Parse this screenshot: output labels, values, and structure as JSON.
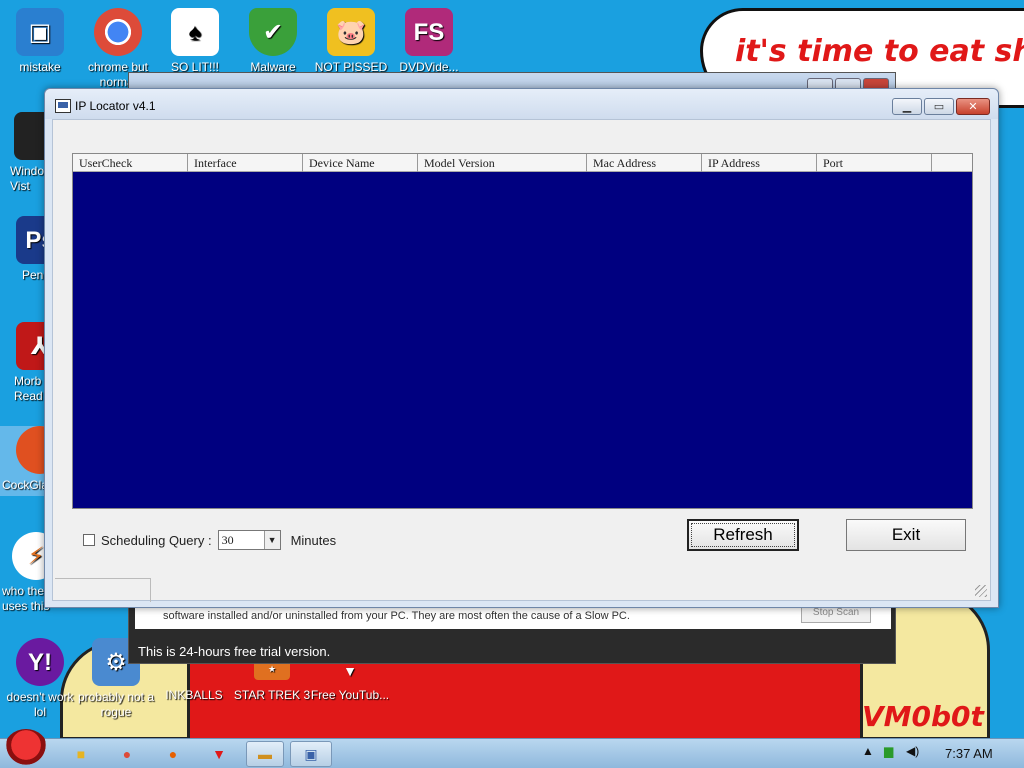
{
  "wallpaper": {
    "bubble_text": "it's time to eat shit and show",
    "signature": "VM0b0t"
  },
  "desktop_icons": [
    {
      "label": "mistake",
      "icon": "computer-icon",
      "color": "#2a7fd0"
    },
    {
      "label": "chrome but normal",
      "icon": "chrome-icon",
      "color": "#dd4b39"
    },
    {
      "label": "SO LIT!!!",
      "icon": "cards-icon",
      "color": "#ffffff"
    },
    {
      "label": "Malware",
      "icon": "shield-icon",
      "color": "#3aa03a"
    },
    {
      "label": "NOT PISSED",
      "icon": "angry-pig-icon",
      "color": "#f0c020"
    },
    {
      "label": "DVDVide...",
      "icon": "fs-icon",
      "color": "#b02a7a",
      "text": "FS"
    },
    {
      "label": "Windo Vist",
      "icon": "trash-icon",
      "color": "#222222"
    },
    {
      "label": "Pen",
      "icon": "photoshop-icon",
      "color": "#1a3a8a",
      "text": "Ps"
    },
    {
      "label": "Morb Read",
      "icon": "pdf-icon",
      "color": "#c01818"
    },
    {
      "label": "CockGla",
      "icon": "app-icon",
      "color": "#e05020"
    },
    {
      "label": "who the uses this",
      "icon": "lightning-icon",
      "color": "#ffffff"
    },
    {
      "label": "doesn't work lol",
      "icon": "yahoo-icon",
      "color": "#6a1aa0"
    },
    {
      "label": "probably not a rogue",
      "icon": "gear-computer-icon",
      "color": "#4a8ad0"
    },
    {
      "label": "INKBALLS",
      "icon": "inkballs-icon",
      "color": "#e05020"
    },
    {
      "label": "STAR TREK 3",
      "icon": "star-trek-icon",
      "color": "#e07020"
    },
    {
      "label": "Free YouTub...",
      "icon": "youtube-download-icon",
      "color": "#e01818"
    }
  ],
  "background_window": {
    "message": "software installed and/or uninstalled from your PC. They are most often the cause of a Slow PC.",
    "button": "Stop Scan",
    "trial": "This is 24-hours free trial version."
  },
  "window": {
    "title": "IP Locator v4.1",
    "columns": [
      "UserCheck",
      "Interface",
      "Device Name",
      "Model Version",
      "Mac Address",
      "IP Address",
      "Port"
    ],
    "rows": [],
    "scheduling_label": "Scheduling Query :",
    "scheduling_checked": false,
    "interval_value": "30",
    "interval_unit": "Minutes",
    "refresh_label": "Refresh",
    "exit_label": "Exit",
    "list_bg": "#000080"
  },
  "taskbar": {
    "clock": "7:37 AM",
    "items": [
      "explorer-icon",
      "chrome-icon",
      "firefox-icon",
      "download-icon",
      "folder-icon",
      "ip-locator-icon"
    ]
  }
}
